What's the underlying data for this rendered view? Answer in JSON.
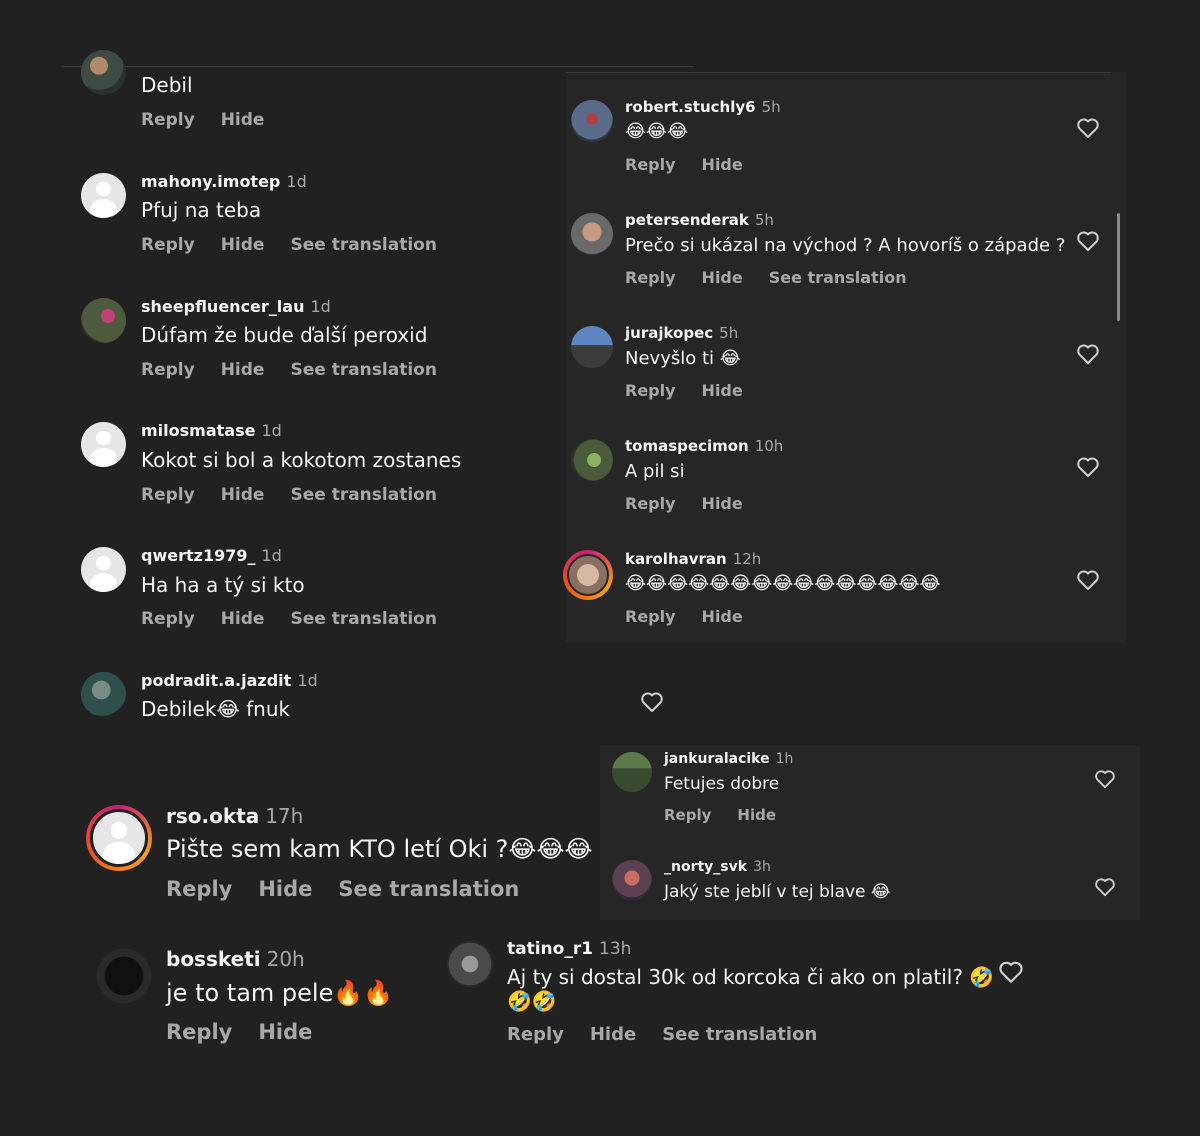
{
  "labels": {
    "reply": "Reply",
    "hide": "Hide",
    "see_translation": "See translation"
  },
  "left_comments": [
    {
      "user": "",
      "time": "",
      "text": "Debil"
    },
    {
      "user": "mahony.imotep",
      "time": "1d",
      "text": "Pfuj na teba"
    },
    {
      "user": "sheepfluencer_lau",
      "time": "1d",
      "text": "Dúfam že bude ďalší peroxid"
    },
    {
      "user": "milosmatase",
      "time": "1d",
      "text": "Kokot si bol a kokotom zostanes"
    },
    {
      "user": "qwertz1979_",
      "time": "1d",
      "text": "Ha ha a tý si kto"
    },
    {
      "user": "podradit.a.jazdit",
      "time": "1d",
      "text": "Debilek😂 fnuk"
    }
  ],
  "right_comments": [
    {
      "user": "robert.stuchly6",
      "time": "5h",
      "text": "😂😂😂"
    },
    {
      "user": "petersenderak",
      "time": "5h",
      "text": "Prečo si ukázal na východ ? A hovoríš o západe ?"
    },
    {
      "user": "jurajkopec",
      "time": "5h",
      "text": "Nevyšlo ti 😂"
    },
    {
      "user": "tomaspecimon",
      "time": "10h",
      "text": "A pil si"
    },
    {
      "user": "karolhavran",
      "time": "12h",
      "text": "😂😂😂😂😂😂😂😂😂😂😂😂😂😂😂"
    }
  ],
  "mid_comments": [
    {
      "user": "jankuralacike",
      "time": "1h",
      "text": "Fetujes dobre"
    },
    {
      "user": "_norty_svk",
      "time": "3h",
      "text": "Jaký ste jeblí v tej blave 😂"
    }
  ],
  "big_comments": [
    {
      "user": "rso.okta",
      "time": "17h",
      "text": "Pište sem kam KTO letí Oki ?😂😂😂"
    },
    {
      "user": "bossketi",
      "time": "20h",
      "text": "je to tam pele🔥🔥"
    }
  ],
  "tatino": {
    "user": "tatino_r1",
    "time": "13h",
    "text1": "Aj ty si dostal 30k od korcoka či ako on platil? 🤣",
    "text2": "🤣🤣"
  },
  "colors": {
    "bg": "#212121",
    "text": "#f4f4f4",
    "muted": "#a8a8a8"
  },
  "icons": {
    "heart": "heart-outline-icon"
  }
}
